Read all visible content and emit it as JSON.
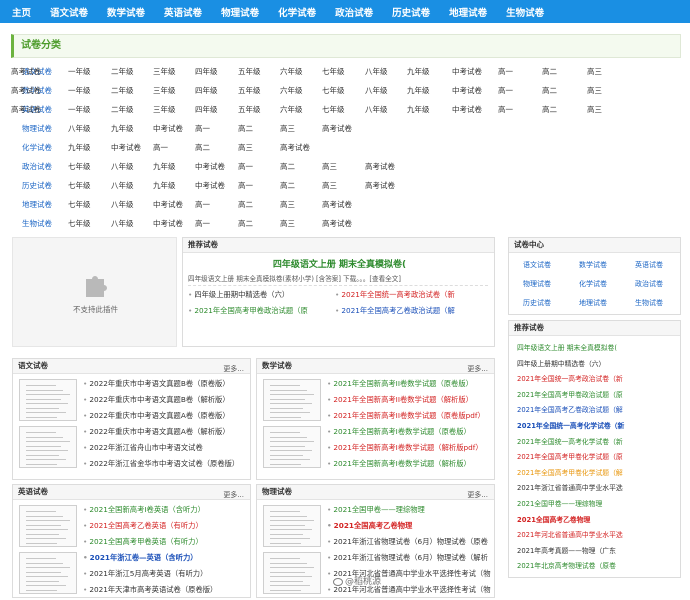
{
  "nav": [
    "主页",
    "语文试卷",
    "数学试卷",
    "英语试卷",
    "物理试卷",
    "化学试卷",
    "政治试卷",
    "历史试卷",
    "地理试卷",
    "生物试卷"
  ],
  "category_title": "试卷分类",
  "categories": [
    {
      "subject": "语文试卷",
      "items": [
        "一年级",
        "二年级",
        "三年级",
        "四年级",
        "五年级",
        "六年级",
        "七年级",
        "八年级",
        "九年级",
        "中考试卷",
        "高一",
        "高二",
        "高三",
        "高考试卷"
      ]
    },
    {
      "subject": "数学试卷",
      "items": [
        "一年级",
        "二年级",
        "三年级",
        "四年级",
        "五年级",
        "六年级",
        "七年级",
        "八年级",
        "九年级",
        "中考试卷",
        "高一",
        "高二",
        "高三",
        "高考试卷"
      ]
    },
    {
      "subject": "英语试卷",
      "items": [
        "一年级",
        "二年级",
        "三年级",
        "四年级",
        "五年级",
        "六年级",
        "七年级",
        "八年级",
        "九年级",
        "中考试卷",
        "高一",
        "高二",
        "高三",
        "高考试卷"
      ]
    },
    {
      "subject": "物理试卷",
      "items": [
        "八年级",
        "九年级",
        "中考试卷",
        "高一",
        "高二",
        "高三",
        "高考试卷"
      ]
    },
    {
      "subject": "化学试卷",
      "items": [
        "九年级",
        "中考试卷",
        "高一",
        "高二",
        "高三",
        "高考试卷"
      ]
    },
    {
      "subject": "政治试卷",
      "items": [
        "七年级",
        "八年级",
        "九年级",
        "中考试卷",
        "高一",
        "高二",
        "高三",
        "高考试卷"
      ]
    },
    {
      "subject": "历史试卷",
      "items": [
        "七年级",
        "八年级",
        "九年级",
        "中考试卷",
        "高一",
        "高二",
        "高三",
        "高考试卷"
      ]
    },
    {
      "subject": "地理试卷",
      "items": [
        "七年级",
        "八年级",
        "中考试卷",
        "高一",
        "高二",
        "高三",
        "高考试卷"
      ]
    },
    {
      "subject": "生物试卷",
      "items": [
        "七年级",
        "八年级",
        "中考试卷",
        "高一",
        "高二",
        "高三",
        "高考试卷"
      ]
    }
  ],
  "plugin_box": {
    "text": "不支持此插件"
  },
  "recommend": {
    "title": "推荐试卷",
    "headline": "四年级语文上册 期末全真模拟卷(",
    "summary": "四年级语文上册 期末全真模拟卷(素材小学) [含答案] 下载。。。[查看全文]",
    "links": [
      {
        "text": "四年级上册期中精选卷（六）",
        "color": "k"
      },
      {
        "text": "2021年全国统一高考政治试卷（新",
        "color": "r"
      },
      {
        "text": "2021年全国高考甲卷政治试题（原",
        "color": "g"
      },
      {
        "text": "2021年全国高考乙卷政治试题（解",
        "color": "b"
      }
    ]
  },
  "exam_center": {
    "title": "试卷中心",
    "items": [
      "语文试卷",
      "数学试卷",
      "英语试卷",
      "物理试卷",
      "化学试卷",
      "政治试卷",
      "历史试卷",
      "地理试卷",
      "生物试卷"
    ]
  },
  "side_recommend": {
    "title": "推荐试卷",
    "items": [
      {
        "text": "四年级语文上册 期末全真模拟卷(",
        "color": "g",
        "bold": false
      },
      {
        "text": "四年级上册期中精选卷（六）",
        "color": "k",
        "bold": false
      },
      {
        "text": "2021年全国统一高考政治试卷（新",
        "color": "r",
        "bold": false
      },
      {
        "text": "2021年全国高考甲卷政治试题（原",
        "color": "g",
        "bold": false
      },
      {
        "text": "2021年全国高考乙卷政治试题（解",
        "color": "b",
        "bold": false
      },
      {
        "text": "2021年全国统一高考化学试卷（新",
        "color": "b",
        "bold": true
      },
      {
        "text": "2021年全国统一高考化学试卷（新",
        "color": "g",
        "bold": false
      },
      {
        "text": "2021年全国高考甲卷化学试题（原",
        "color": "r",
        "bold": false
      },
      {
        "text": "2021年全国高考甲卷化学试题（解",
        "color": "o",
        "bold": false
      },
      {
        "text": "2021年浙江省普通高中学业水平选",
        "color": "k",
        "bold": false
      },
      {
        "text": "2021全国甲卷——理综物理",
        "color": "g",
        "bold": false
      },
      {
        "text": "2021全国高考乙卷物理",
        "color": "r",
        "bold": true
      },
      {
        "text": "2021年河北省普通高中学业水平选",
        "color": "r",
        "bold": false
      },
      {
        "text": "2021年高考真题——物理（广东",
        "color": "k",
        "bold": false
      },
      {
        "text": "2021年北京高考物理试卷（原卷",
        "color": "g",
        "bold": false
      }
    ]
  },
  "panels": [
    {
      "title": "语文试卷",
      "more": "更多...",
      "items": [
        {
          "text": "2022年重庆市中考语文真题B卷（原卷版）",
          "color": "k"
        },
        {
          "text": "2022年重庆市中考语文真题B卷（解析版）",
          "color": "k"
        },
        {
          "text": "2022年重庆市中考语文真题A卷（原卷版）",
          "color": "k"
        },
        {
          "text": "2022年重庆市中考语文真题A卷（解析版）",
          "color": "k"
        },
        {
          "text": "2022年浙江省舟山市中考语文试卷",
          "color": "k"
        },
        {
          "text": "2022年浙江省金华市中考语文试卷（原卷版）",
          "color": "k"
        }
      ]
    },
    {
      "title": "数学试卷",
      "more": "更多...",
      "items": [
        {
          "text": "2021年全国新高考II卷数学试题（原卷版）",
          "color": "g"
        },
        {
          "text": "2021年全国新高考II卷数学试题（解析版）",
          "color": "r"
        },
        {
          "text": "2021年全国新高考II卷数学试题（原卷版pdf）",
          "color": "r"
        },
        {
          "text": "2021年全国新高考I卷数学试题（原卷版）",
          "color": "g"
        },
        {
          "text": "2021年全国新高考I卷数学试题（解析版pdf）",
          "color": "r"
        },
        {
          "text": "2021年全国新高考I卷数学试题（解析版）",
          "color": "g"
        }
      ]
    },
    {
      "title": "英语试卷",
      "more": "更多...",
      "items": [
        {
          "text": "2021全国新高考I卷英语（含听力）",
          "color": "g",
          "bold": false
        },
        {
          "text": "2021全国高考乙卷英语（有听力）",
          "color": "r",
          "bold": false
        },
        {
          "text": "2021全国高考甲卷英语（有听力）",
          "color": "g",
          "bold": false
        },
        {
          "text": "2021年浙江卷—英语（含听力）",
          "color": "b",
          "bold": true
        },
        {
          "text": "2021年浙江5月高考英语（有听力）",
          "color": "k",
          "bold": false
        },
        {
          "text": "2021年天津市高考英语试卷（原卷版）",
          "color": "k",
          "bold": false
        }
      ]
    },
    {
      "title": "物理试卷",
      "more": "更多...",
      "items": [
        {
          "text": "2021全国甲卷——理综物理",
          "color": "g",
          "bold": false
        },
        {
          "text": "2021全国高考乙卷物理",
          "color": "r",
          "bold": true
        },
        {
          "text": "2021年浙江省物理试卷（6月）物理试卷（原卷",
          "color": "k",
          "bold": false
        },
        {
          "text": "2021年浙江省物理试卷（6月）物理试卷（解析",
          "color": "k",
          "bold": false
        },
        {
          "text": "2021年河北省普通高中学业水平选择性考试（物",
          "color": "k",
          "bold": false
        },
        {
          "text": "2021年河北省普通高中学业水平选择性考试（物",
          "color": "k",
          "bold": false
        }
      ]
    }
  ],
  "watermark": "@稻桃源"
}
